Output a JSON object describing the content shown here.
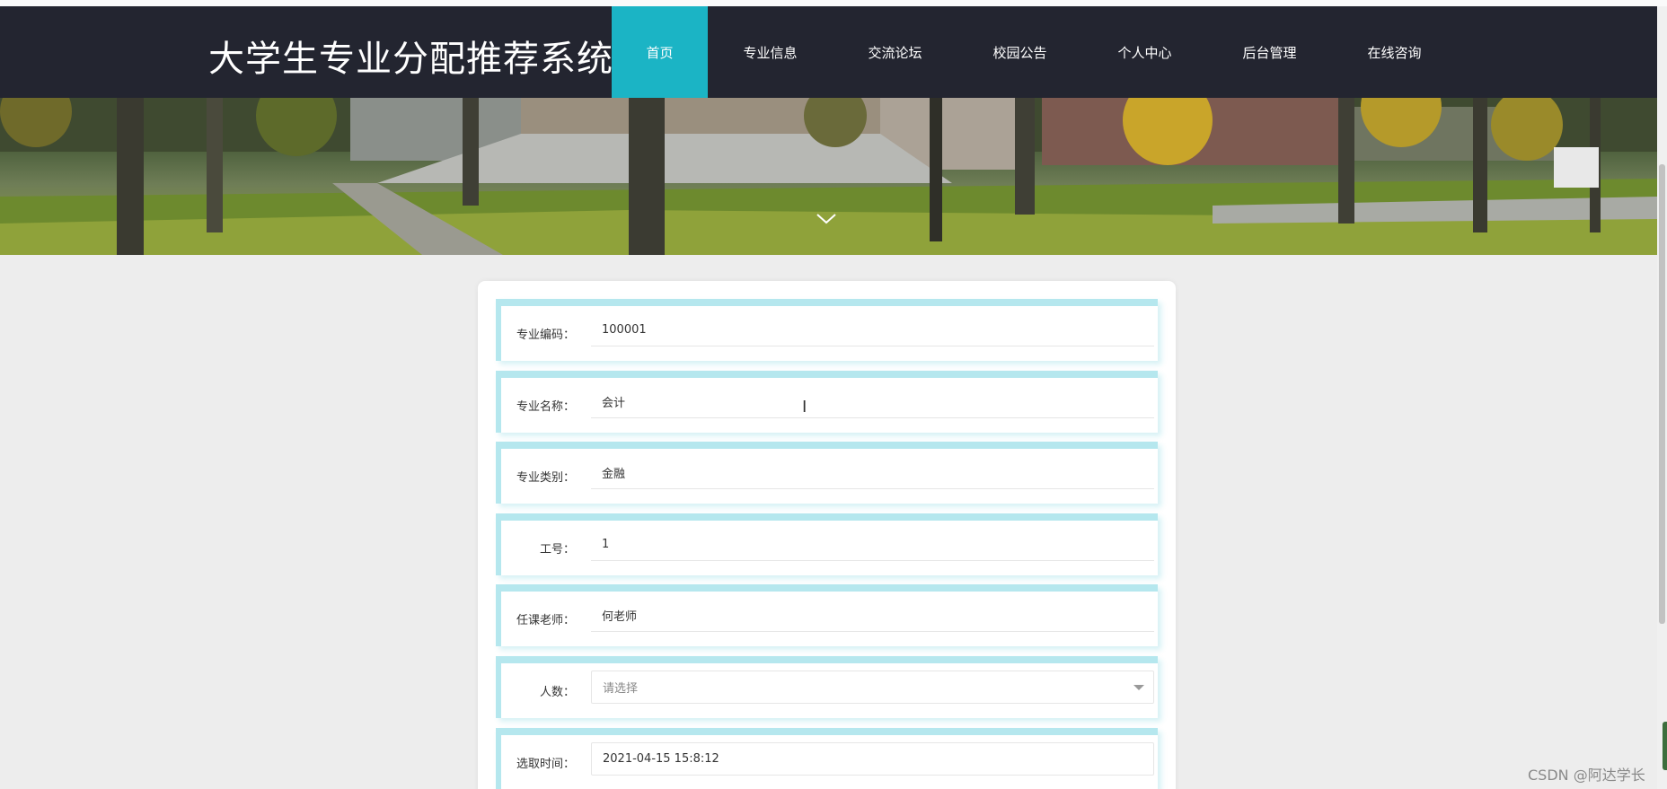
{
  "site": {
    "title": "大学生专业分配推荐系统"
  },
  "nav": [
    {
      "label": "首页",
      "active": true
    },
    {
      "label": "专业信息"
    },
    {
      "label": "交流论坛"
    },
    {
      "label": "校园公告"
    },
    {
      "label": "个人中心"
    },
    {
      "label": "后台管理"
    },
    {
      "label": "在线咨询"
    }
  ],
  "form": {
    "rows": [
      {
        "label": "专业编码：",
        "value": "100001"
      },
      {
        "label": "专业名称：",
        "value": "会计"
      },
      {
        "label": "专业类别：",
        "value": "金融"
      },
      {
        "label": "工号：",
        "value": "1"
      },
      {
        "label": "任课老师：",
        "value": "何老师"
      },
      {
        "label": "人数：",
        "placeholder": "请选择"
      },
      {
        "label": "选取时间：",
        "value": "2021-04-15 15:8:12"
      }
    ]
  },
  "watermark": "CSDN @阿达学长",
  "colors": {
    "header_bg": "#232530",
    "accent": "#1bb4c5",
    "row_border": "#b5e7ee",
    "page_bg": "#ededed"
  }
}
